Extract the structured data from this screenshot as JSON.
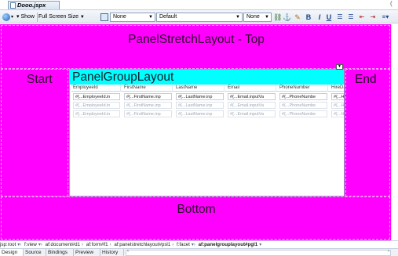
{
  "file_tab": {
    "title": "Dooo.jspx"
  },
  "toolbar": {
    "show_label": "Show",
    "screen_size": "Full Screen Size",
    "class_select": "None",
    "font_select": "Default",
    "size_select": "None"
  },
  "layout": {
    "top_label": "PanelStretchLayout - Top",
    "start_label": "Start",
    "end_label": "End",
    "bottom_label": "Bottom",
    "panel_group_label": "PanelGroupLayout",
    "colors": {
      "stretch_bg": "#ff00ff",
      "group_header_bg": "#00ffff"
    }
  },
  "table": {
    "headers": [
      "EmployeeId",
      "FirstName",
      "LastName",
      "Email",
      "PhoneNumber",
      "HireDa"
    ],
    "rows": [
      [
        "#{...EmployeeId.in",
        "#{...FirstName.inp",
        "#{...LastName.inp",
        "#{...Email.inputVa",
        "#{...PhoneNumbe",
        "#{...H"
      ],
      [
        "#{...EmployeeId.in",
        "#{...FirstName.inp",
        "#{...LastName.inp",
        "#{...Email.inputVa",
        "#{...PhoneNumbe",
        "#{...H"
      ],
      [
        "#{...EmployeeId.in",
        "#{...FirstName.inp",
        "#{...LastName.inp",
        "#{...Email.inputVa",
        "#{...PhoneNumbe",
        "#{...H"
      ]
    ]
  },
  "breadcrumb": [
    "jsp:root",
    "f:view",
    "af:document#d1",
    "af:form#f1",
    "af:panelstretchlayout#psl1",
    "f:facet",
    "af:panelgrouplayout#pgl1"
  ],
  "bottom_tabs": [
    "Design",
    "Source",
    "Bindings",
    "Preview",
    "History"
  ]
}
